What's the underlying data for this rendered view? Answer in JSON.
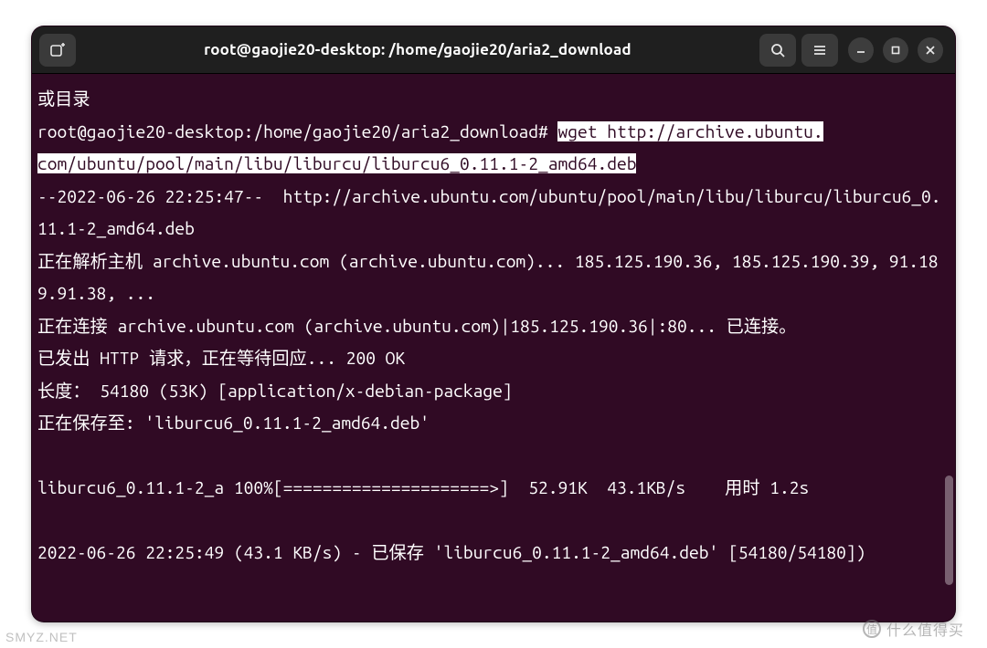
{
  "window": {
    "title": "root@gaojie20-desktop: /home/gaojie20/aria2_download"
  },
  "titlebar": {
    "icons": {
      "new_tab": "new-tab-icon",
      "search": "search-icon",
      "menu": "hamburger-icon",
      "minimize": "minimize-icon",
      "maximize": "maximize-icon",
      "close": "close-icon"
    }
  },
  "terminal": {
    "line_prev": "或目录",
    "prompt": "root@gaojie20-desktop:/home/gaojie20/aria2_download# ",
    "cmd_part1": "wget http://archive.ubuntu.",
    "cmd_part2": "com/ubuntu/pool/main/libu/liburcu/liburcu6_0.11.1-2_amd64.deb",
    "out1": "--2022-06-26 22:25:47--  http://archive.ubuntu.com/ubuntu/pool/main/libu/liburcu/liburcu6_0.11.1-2_amd64.deb",
    "out2": "正在解析主机 archive.ubuntu.com (archive.ubuntu.com)... 185.125.190.36, 185.125.190.39, 91.189.91.38, ...",
    "out3": "正在连接 archive.ubuntu.com (archive.ubuntu.com)|185.125.190.36|:80... 已连接。",
    "out4": "已发出 HTTP 请求，正在等待回应... 200 OK",
    "out5": "长度： 54180 (53K) [application/x-debian-package]",
    "out6": "正在保存至: 'liburcu6_0.11.1-2_amd64.deb'",
    "blank": "",
    "progress": "liburcu6_0.11.1-2_a 100%[=====================>]  52.91K  43.1KB/s    用时 1.2s",
    "out7": "2022-06-26 22:25:49 (43.1 KB/s) - 已保存 'liburcu6_0.11.1-2_amd64.deb' [54180/54180])"
  },
  "watermark": {
    "smyz": "SMYZ.NET",
    "zdm": "值 什么值得买"
  }
}
